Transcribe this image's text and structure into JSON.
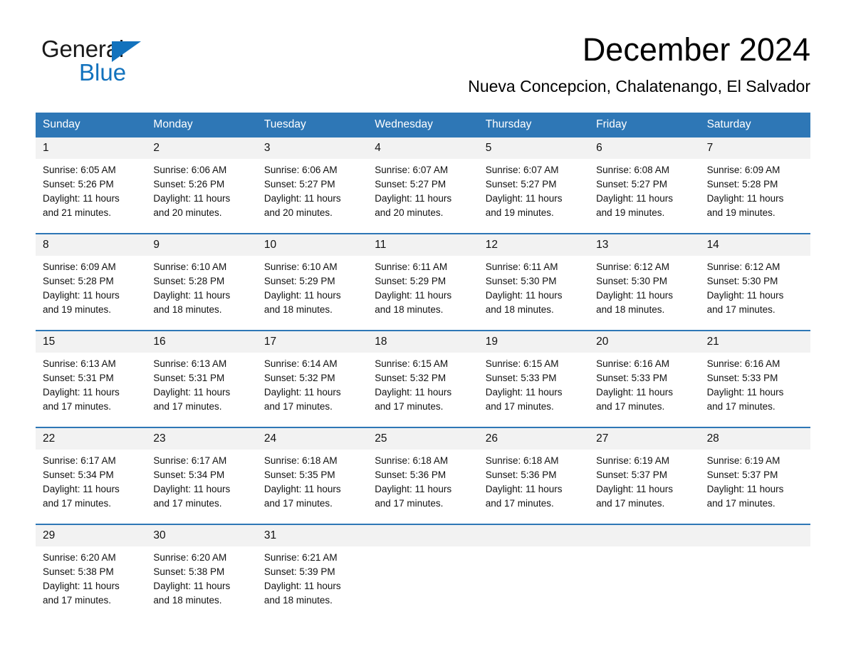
{
  "brand": {
    "line1": "General",
    "line2": "Blue",
    "triangle_color": "#1272bd",
    "text_color": "#1a1a1a"
  },
  "header": {
    "title": "December 2024",
    "subtitle": "Nueva Concepcion, Chalatenango, El Salvador"
  },
  "theme": {
    "header_blue": "#2e77b6",
    "daynum_gray": "#f2f2f2",
    "text_black": "#111111",
    "header_text": "#ffffff"
  },
  "weekdays": [
    "Sunday",
    "Monday",
    "Tuesday",
    "Wednesday",
    "Thursday",
    "Friday",
    "Saturday"
  ],
  "weeks": [
    [
      {
        "day": "1",
        "sunrise": "Sunrise: 6:05 AM",
        "sunset": "Sunset: 5:26 PM",
        "daylight1": "Daylight: 11 hours",
        "daylight2": "and 21 minutes."
      },
      {
        "day": "2",
        "sunrise": "Sunrise: 6:06 AM",
        "sunset": "Sunset: 5:26 PM",
        "daylight1": "Daylight: 11 hours",
        "daylight2": "and 20 minutes."
      },
      {
        "day": "3",
        "sunrise": "Sunrise: 6:06 AM",
        "sunset": "Sunset: 5:27 PM",
        "daylight1": "Daylight: 11 hours",
        "daylight2": "and 20 minutes."
      },
      {
        "day": "4",
        "sunrise": "Sunrise: 6:07 AM",
        "sunset": "Sunset: 5:27 PM",
        "daylight1": "Daylight: 11 hours",
        "daylight2": "and 20 minutes."
      },
      {
        "day": "5",
        "sunrise": "Sunrise: 6:07 AM",
        "sunset": "Sunset: 5:27 PM",
        "daylight1": "Daylight: 11 hours",
        "daylight2": "and 19 minutes."
      },
      {
        "day": "6",
        "sunrise": "Sunrise: 6:08 AM",
        "sunset": "Sunset: 5:27 PM",
        "daylight1": "Daylight: 11 hours",
        "daylight2": "and 19 minutes."
      },
      {
        "day": "7",
        "sunrise": "Sunrise: 6:09 AM",
        "sunset": "Sunset: 5:28 PM",
        "daylight1": "Daylight: 11 hours",
        "daylight2": "and 19 minutes."
      }
    ],
    [
      {
        "day": "8",
        "sunrise": "Sunrise: 6:09 AM",
        "sunset": "Sunset: 5:28 PM",
        "daylight1": "Daylight: 11 hours",
        "daylight2": "and 19 minutes."
      },
      {
        "day": "9",
        "sunrise": "Sunrise: 6:10 AM",
        "sunset": "Sunset: 5:28 PM",
        "daylight1": "Daylight: 11 hours",
        "daylight2": "and 18 minutes."
      },
      {
        "day": "10",
        "sunrise": "Sunrise: 6:10 AM",
        "sunset": "Sunset: 5:29 PM",
        "daylight1": "Daylight: 11 hours",
        "daylight2": "and 18 minutes."
      },
      {
        "day": "11",
        "sunrise": "Sunrise: 6:11 AM",
        "sunset": "Sunset: 5:29 PM",
        "daylight1": "Daylight: 11 hours",
        "daylight2": "and 18 minutes."
      },
      {
        "day": "12",
        "sunrise": "Sunrise: 6:11 AM",
        "sunset": "Sunset: 5:30 PM",
        "daylight1": "Daylight: 11 hours",
        "daylight2": "and 18 minutes."
      },
      {
        "day": "13",
        "sunrise": "Sunrise: 6:12 AM",
        "sunset": "Sunset: 5:30 PM",
        "daylight1": "Daylight: 11 hours",
        "daylight2": "and 18 minutes."
      },
      {
        "day": "14",
        "sunrise": "Sunrise: 6:12 AM",
        "sunset": "Sunset: 5:30 PM",
        "daylight1": "Daylight: 11 hours",
        "daylight2": "and 17 minutes."
      }
    ],
    [
      {
        "day": "15",
        "sunrise": "Sunrise: 6:13 AM",
        "sunset": "Sunset: 5:31 PM",
        "daylight1": "Daylight: 11 hours",
        "daylight2": "and 17 minutes."
      },
      {
        "day": "16",
        "sunrise": "Sunrise: 6:13 AM",
        "sunset": "Sunset: 5:31 PM",
        "daylight1": "Daylight: 11 hours",
        "daylight2": "and 17 minutes."
      },
      {
        "day": "17",
        "sunrise": "Sunrise: 6:14 AM",
        "sunset": "Sunset: 5:32 PM",
        "daylight1": "Daylight: 11 hours",
        "daylight2": "and 17 minutes."
      },
      {
        "day": "18",
        "sunrise": "Sunrise: 6:15 AM",
        "sunset": "Sunset: 5:32 PM",
        "daylight1": "Daylight: 11 hours",
        "daylight2": "and 17 minutes."
      },
      {
        "day": "19",
        "sunrise": "Sunrise: 6:15 AM",
        "sunset": "Sunset: 5:33 PM",
        "daylight1": "Daylight: 11 hours",
        "daylight2": "and 17 minutes."
      },
      {
        "day": "20",
        "sunrise": "Sunrise: 6:16 AM",
        "sunset": "Sunset: 5:33 PM",
        "daylight1": "Daylight: 11 hours",
        "daylight2": "and 17 minutes."
      },
      {
        "day": "21",
        "sunrise": "Sunrise: 6:16 AM",
        "sunset": "Sunset: 5:33 PM",
        "daylight1": "Daylight: 11 hours",
        "daylight2": "and 17 minutes."
      }
    ],
    [
      {
        "day": "22",
        "sunrise": "Sunrise: 6:17 AM",
        "sunset": "Sunset: 5:34 PM",
        "daylight1": "Daylight: 11 hours",
        "daylight2": "and 17 minutes."
      },
      {
        "day": "23",
        "sunrise": "Sunrise: 6:17 AM",
        "sunset": "Sunset: 5:34 PM",
        "daylight1": "Daylight: 11 hours",
        "daylight2": "and 17 minutes."
      },
      {
        "day": "24",
        "sunrise": "Sunrise: 6:18 AM",
        "sunset": "Sunset: 5:35 PM",
        "daylight1": "Daylight: 11 hours",
        "daylight2": "and 17 minutes."
      },
      {
        "day": "25",
        "sunrise": "Sunrise: 6:18 AM",
        "sunset": "Sunset: 5:36 PM",
        "daylight1": "Daylight: 11 hours",
        "daylight2": "and 17 minutes."
      },
      {
        "day": "26",
        "sunrise": "Sunrise: 6:18 AM",
        "sunset": "Sunset: 5:36 PM",
        "daylight1": "Daylight: 11 hours",
        "daylight2": "and 17 minutes."
      },
      {
        "day": "27",
        "sunrise": "Sunrise: 6:19 AM",
        "sunset": "Sunset: 5:37 PM",
        "daylight1": "Daylight: 11 hours",
        "daylight2": "and 17 minutes."
      },
      {
        "day": "28",
        "sunrise": "Sunrise: 6:19 AM",
        "sunset": "Sunset: 5:37 PM",
        "daylight1": "Daylight: 11 hours",
        "daylight2": "and 17 minutes."
      }
    ],
    [
      {
        "day": "29",
        "sunrise": "Sunrise: 6:20 AM",
        "sunset": "Sunset: 5:38 PM",
        "daylight1": "Daylight: 11 hours",
        "daylight2": "and 17 minutes."
      },
      {
        "day": "30",
        "sunrise": "Sunrise: 6:20 AM",
        "sunset": "Sunset: 5:38 PM",
        "daylight1": "Daylight: 11 hours",
        "daylight2": "and 18 minutes."
      },
      {
        "day": "31",
        "sunrise": "Sunrise: 6:21 AM",
        "sunset": "Sunset: 5:39 PM",
        "daylight1": "Daylight: 11 hours",
        "daylight2": "and 18 minutes."
      },
      {
        "day": "",
        "sunrise": "",
        "sunset": "",
        "daylight1": "",
        "daylight2": ""
      },
      {
        "day": "",
        "sunrise": "",
        "sunset": "",
        "daylight1": "",
        "daylight2": ""
      },
      {
        "day": "",
        "sunrise": "",
        "sunset": "",
        "daylight1": "",
        "daylight2": ""
      },
      {
        "day": "",
        "sunrise": "",
        "sunset": "",
        "daylight1": "",
        "daylight2": ""
      }
    ]
  ]
}
